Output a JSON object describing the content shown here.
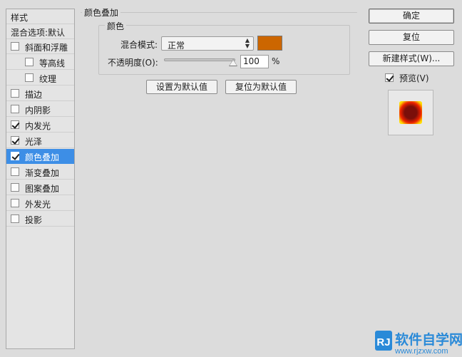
{
  "styles_panel": {
    "header": "样式",
    "blending_options": "混合选项:默认",
    "items": [
      {
        "label": "斜面和浮雕",
        "checked": false
      },
      {
        "label": "等高线",
        "checked": false
      },
      {
        "label": "纹理",
        "checked": false
      },
      {
        "label": "描边",
        "checked": false
      },
      {
        "label": "内阴影",
        "checked": false
      },
      {
        "label": "内发光",
        "checked": true
      },
      {
        "label": "光泽",
        "checked": true
      },
      {
        "label": "颜色叠加",
        "checked": true
      },
      {
        "label": "渐变叠加",
        "checked": false
      },
      {
        "label": "图案叠加",
        "checked": false
      },
      {
        "label": "外发光",
        "checked": false
      },
      {
        "label": "投影",
        "checked": false
      }
    ]
  },
  "color_overlay": {
    "title": "颜色叠加",
    "color_group_title": "颜色",
    "blend_mode_label": "混合模式:",
    "blend_mode_value": "正常",
    "overlay_color": "#cc6600",
    "opacity_label": "不透明度(O):",
    "opacity_value": "100",
    "opacity_unit": "%",
    "opacity_level": 1.0,
    "set_default_button": "设置为默认值",
    "reset_default_button": "复位为默认值"
  },
  "right_panel": {
    "ok_button": "确定",
    "reset_button": "复位",
    "new_style_button": "新建样式(W)...",
    "preview_label": "预览(V)",
    "preview_checked": true
  },
  "watermark": {
    "logo_text": "RJ",
    "site_name": "软件自学网",
    "site_url": "www.rjzxw.com"
  },
  "colors": {
    "selection": "#3d8ee6",
    "preview_outer": "#ffdd00",
    "preview_mid": "#ee2200",
    "preview_inner": "#7a0f0a",
    "watermark_blue": "#2a8ad8",
    "watermark_red": "#e23a2a"
  }
}
